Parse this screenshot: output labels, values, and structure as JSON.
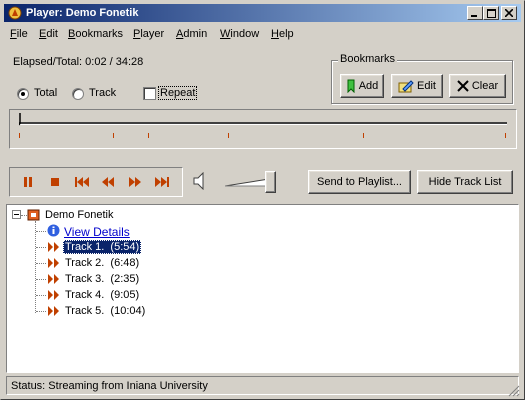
{
  "window": {
    "title": "Player: Demo Fonetik"
  },
  "menu": [
    {
      "label": "File",
      "key": "F",
      "rest": "ile"
    },
    {
      "label": "Edit",
      "key": "E",
      "rest": "dit"
    },
    {
      "label": "Bookmarks",
      "key": "B",
      "rest": "ookmarks"
    },
    {
      "label": "Player",
      "key": "P",
      "rest": "layer"
    },
    {
      "label": "Admin",
      "key": "A",
      "rest": "dmin"
    },
    {
      "label": "Window",
      "key": "W",
      "rest": "indow"
    },
    {
      "label": "Help",
      "key": "H",
      "rest": "elp"
    }
  ],
  "elapsed": {
    "label": "Elapsed/Total:",
    "value": "0:02 / 34:28"
  },
  "mode": {
    "total": "Total",
    "track": "Track",
    "repeat": "Repeat",
    "selected": "total",
    "repeat_checked": false
  },
  "bookmarks": {
    "title": "Bookmarks",
    "add": "Add",
    "edit": "Edit",
    "clear": "Clear"
  },
  "progress": {
    "position_fraction": 0.0,
    "marker_fractions": [
      0.0,
      0.194,
      0.265,
      0.43,
      0.706,
      0.998
    ]
  },
  "player": {
    "volume_fraction": 0.95,
    "send_to_playlist": "Send to Playlist...",
    "hide_track_list": "Hide Track List"
  },
  "tree": {
    "root": "Demo Fonetik",
    "details": "View Details",
    "tracks": [
      {
        "label": "Track 1.  (5:54)",
        "selected": true
      },
      {
        "label": "Track 2.  (6:48)",
        "selected": false
      },
      {
        "label": "Track 3.  (2:35)",
        "selected": false
      },
      {
        "label": "Track 4.  (9:05)",
        "selected": false
      },
      {
        "label": "Track 5.  (10:04)",
        "selected": false
      }
    ]
  },
  "status": {
    "text": "Status: Streaming from Iniana University"
  },
  "colors": {
    "title_start": "#0a246a",
    "title_end": "#a6caf0",
    "accent": "#c04000",
    "link": "#0000cc",
    "selection": "#0a246a"
  }
}
